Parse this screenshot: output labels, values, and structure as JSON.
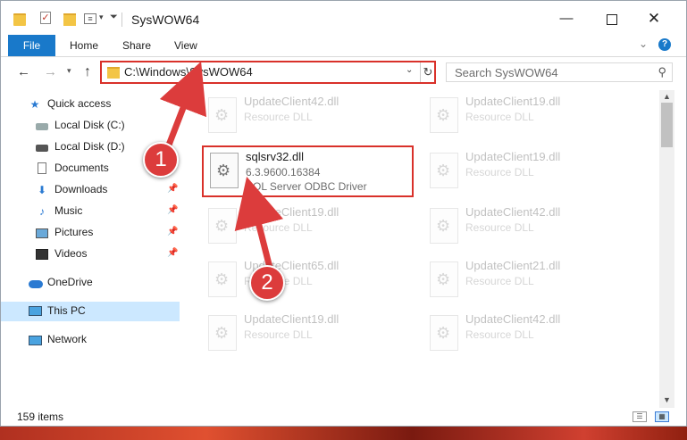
{
  "window": {
    "title": "SysWOW64"
  },
  "ribbon": {
    "tabs": [
      "File",
      "Home",
      "Share",
      "View"
    ],
    "help_label": "?"
  },
  "navigation": {
    "address": "C:\\Windows\\SysWOW64",
    "search_placeholder": "Search SysWOW64"
  },
  "sidebar": {
    "items": [
      {
        "label": "Quick access",
        "icon": "star-icon"
      },
      {
        "label": "Local Disk (C:)",
        "icon": "drive-icon"
      },
      {
        "label": "Local Disk (D:)",
        "icon": "drive-icon"
      },
      {
        "label": "Documents",
        "icon": "documents-icon",
        "pinned": true
      },
      {
        "label": "Downloads",
        "icon": "download-icon",
        "pinned": true
      },
      {
        "label": "Music",
        "icon": "music-icon",
        "pinned": true
      },
      {
        "label": "Pictures",
        "icon": "pictures-icon",
        "pinned": true
      },
      {
        "label": "Videos",
        "icon": "videos-icon",
        "pinned": true
      },
      {
        "label": "OneDrive",
        "icon": "cloud-icon"
      },
      {
        "label": "This PC",
        "icon": "computer-icon",
        "selected": true
      },
      {
        "label": "Network",
        "icon": "network-icon"
      }
    ]
  },
  "files": [
    {
      "name": "UpdateClient42.dll",
      "line2": "Resource DLL",
      "dim": true
    },
    {
      "name": "UpdateClient19.dll",
      "line2": "Resource DLL",
      "dim": true
    },
    {
      "name": "sqlsrv32.dll",
      "line2": "6.3.9600.16384",
      "line3": "SQL Server ODBC Driver",
      "dim": false,
      "highlighted": true
    },
    {
      "name": "UpdateClient19.dll",
      "line2": "Resource DLL",
      "dim": true
    },
    {
      "name": "UpdateClient19.dll",
      "line2": "Resource DLL",
      "dim": true
    },
    {
      "name": "UpdateClient42.dll",
      "line2": "Resource DLL",
      "dim": true
    },
    {
      "name": "UpdateClient65.dll",
      "line2": "Resource DLL",
      "dim": true
    },
    {
      "name": "UpdateClient21.dll",
      "line2": "Resource DLL",
      "dim": true
    },
    {
      "name": "UpdateClient19.dll",
      "line2": "Resource DLL",
      "dim": true
    },
    {
      "name": "UpdateClient42.dll",
      "line2": "Resource DLL",
      "dim": true
    }
  ],
  "status": {
    "item_count": "159 items"
  },
  "annotations": {
    "step1": "1",
    "step2": "2",
    "color": "#dc3c3c"
  }
}
